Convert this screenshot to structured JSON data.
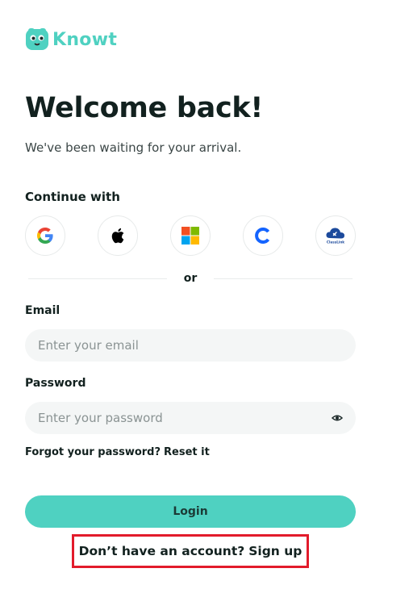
{
  "brand": {
    "name": "Knowt",
    "accent": "#4fd1c1"
  },
  "header": {
    "title": "Welcome back!",
    "subtitle": "We've been waiting for your arrival."
  },
  "sso": {
    "label": "Continue with",
    "providers": [
      {
        "id": "google",
        "icon": "google-icon"
      },
      {
        "id": "apple",
        "icon": "apple-icon"
      },
      {
        "id": "microsoft",
        "icon": "microsoft-icon"
      },
      {
        "id": "clever",
        "icon": "clever-icon"
      },
      {
        "id": "classlink",
        "icon": "classlink-icon",
        "text": "ClassLink"
      }
    ]
  },
  "divider": {
    "text": "or"
  },
  "form": {
    "email": {
      "label": "Email",
      "placeholder": "Enter your email",
      "value": ""
    },
    "password": {
      "label": "Password",
      "placeholder": "Enter your password",
      "value": "",
      "toggle_icon": "eye-icon"
    },
    "forgot_text": "Forgot your password?",
    "reset_link": "Reset it",
    "login_label": "Login"
  },
  "signup": {
    "prompt": "Don’t have an account?",
    "link": "Sign up",
    "highlight_color": "#e21b2b"
  }
}
